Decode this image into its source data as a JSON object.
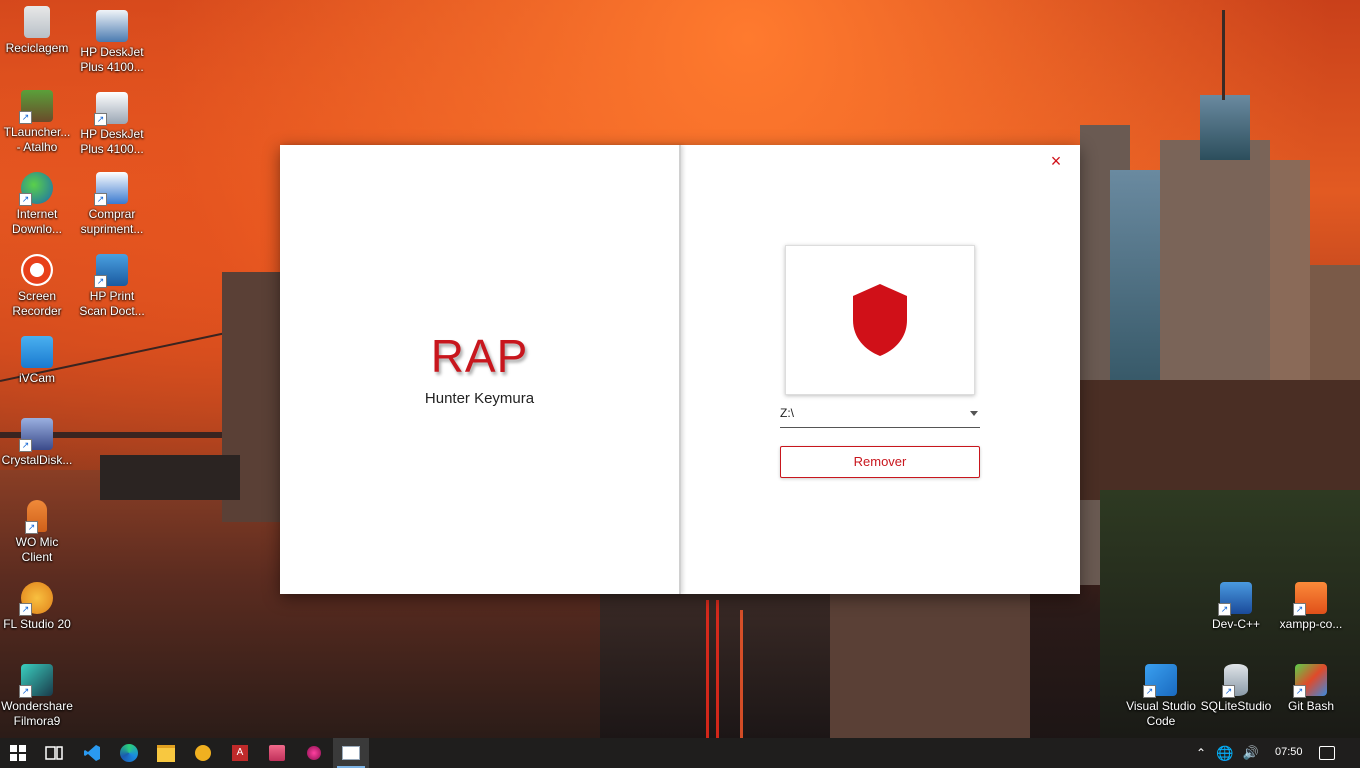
{
  "desktop": {
    "icons": [
      {
        "label": "Reciclagem",
        "icon": "recycle-bin-icon"
      },
      {
        "label": "HP DeskJet Plus 4100...",
        "icon": "printer-icon"
      },
      {
        "label": "TLauncher... - Atalho",
        "icon": "minecraft-icon"
      },
      {
        "label": "HP DeskJet Plus 4100...",
        "icon": "printer-icon"
      },
      {
        "label": "Internet Downlo...",
        "icon": "globe-download-icon"
      },
      {
        "label": "Comprar supriment...",
        "icon": "printer-cart-icon"
      },
      {
        "label": "Screen Recorder",
        "icon": "record-icon"
      },
      {
        "label": "HP Print Scan Doct...",
        "icon": "scan-doctor-icon"
      },
      {
        "label": "iVCam",
        "icon": "webcam-icon"
      },
      {
        "label": "CrystalDisk...",
        "icon": "disk-icon"
      },
      {
        "label": "WO Mic Client",
        "icon": "microphone-icon"
      },
      {
        "label": "FL Studio 20",
        "icon": "fruit-icon"
      },
      {
        "label": "Wondershare Filmora9",
        "icon": "filmora-icon"
      },
      {
        "label": "Dev-C++",
        "icon": "dev-cpp-icon"
      },
      {
        "label": "xampp-co...",
        "icon": "xampp-icon"
      },
      {
        "label": "Visual Studio Code",
        "icon": "vscode-icon"
      },
      {
        "label": "SQLiteStudio",
        "icon": "database-icon"
      },
      {
        "label": "Git Bash",
        "icon": "git-icon"
      }
    ]
  },
  "app": {
    "title": "RAP",
    "subtitle": "Hunter Keymura",
    "close_label": "×",
    "drive_value": "Z:\\",
    "remove_label": "Remover",
    "accent": "#c8161d"
  },
  "taskbar": {
    "clock": "07:50",
    "items": [
      "windows-start-icon",
      "task-view-icon",
      "vscode-icon",
      "edge-icon",
      "file-explorer-icon",
      "app-icon",
      "access-icon",
      "stack-icon",
      "gem-icon",
      "rap-app-icon"
    ]
  }
}
